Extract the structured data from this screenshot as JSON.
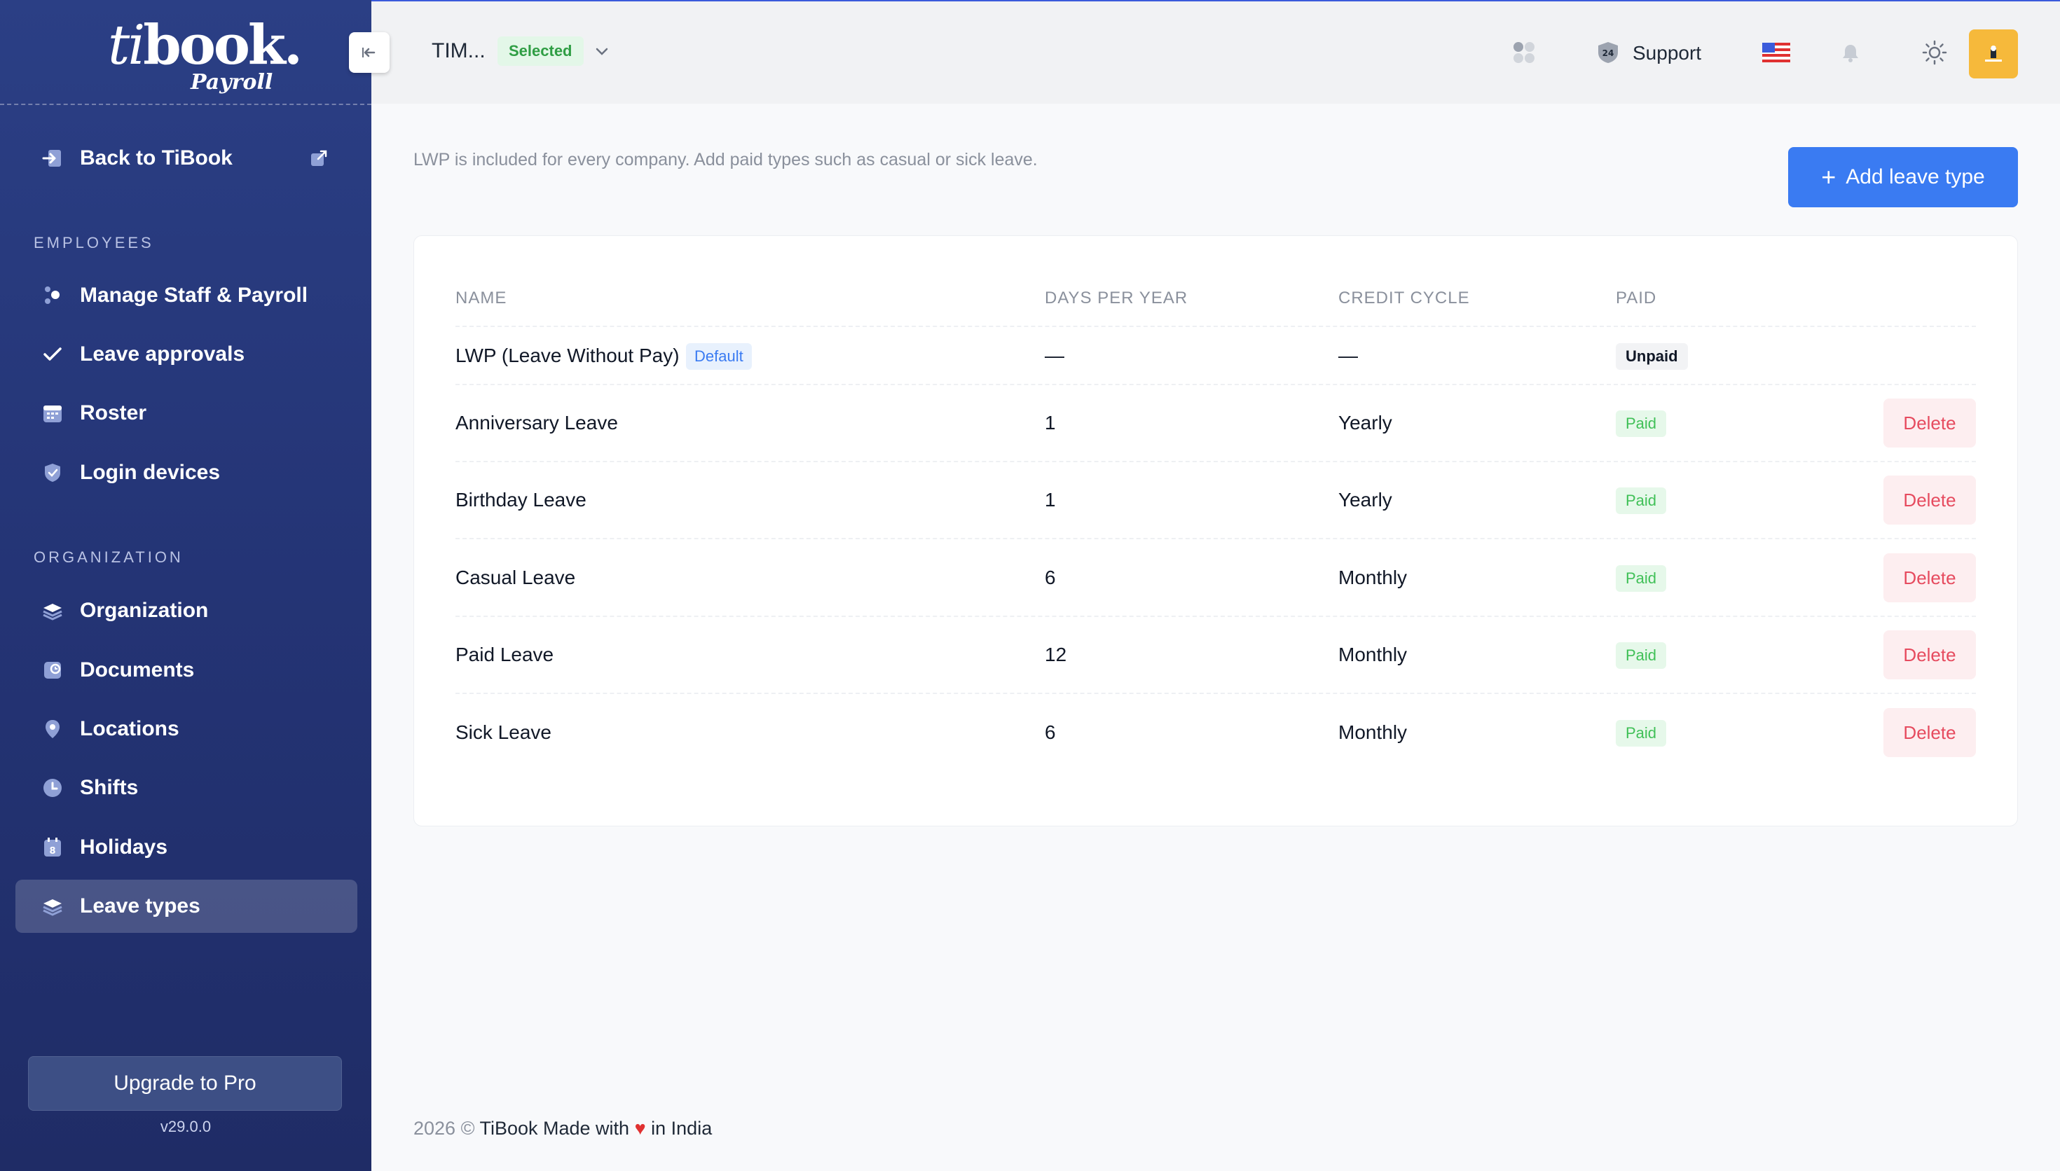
{
  "brand": {
    "logo_ti": "ti",
    "logo_book": "book.",
    "logo_sub": "Payroll"
  },
  "sidebar": {
    "back": "Back to TiBook",
    "section_employees": "EMPLOYEES",
    "section_organization": "ORGANIZATION",
    "items": [
      {
        "label": "Manage Staff & Payroll",
        "icon": "staff-icon"
      },
      {
        "label": "Leave approvals",
        "icon": "check-icon"
      },
      {
        "label": "Roster",
        "icon": "calendar-icon"
      },
      {
        "label": "Login devices",
        "icon": "shield-icon"
      },
      {
        "label": "Organization",
        "icon": "layers-icon"
      },
      {
        "label": "Documents",
        "icon": "document-icon"
      },
      {
        "label": "Locations",
        "icon": "location-pin-icon"
      },
      {
        "label": "Shifts",
        "icon": "clock-icon"
      },
      {
        "label": "Holidays",
        "icon": "calendar-8-icon"
      },
      {
        "label": "Leave types",
        "icon": "layers-icon",
        "active": true
      }
    ],
    "upgrade": "Upgrade to Pro",
    "version": "v29.0.0"
  },
  "header": {
    "company": "TIM...",
    "selected": "Selected",
    "support": "Support",
    "support_badge": "24"
  },
  "main": {
    "description": "LWP is included for every company. Add paid types such as casual or sick leave.",
    "add_button": "Add leave type",
    "columns": [
      "NAME",
      "DAYS PER YEAR",
      "CREDIT CYCLE",
      "PAID"
    ],
    "rows": [
      {
        "name": "LWP (Leave Without Pay)",
        "badge": "Default",
        "days": "—",
        "cycle": "—",
        "paid": "Unpaid"
      },
      {
        "name": "Anniversary Leave",
        "days": "1",
        "cycle": "Yearly",
        "paid": "Paid",
        "action": "Delete"
      },
      {
        "name": "Birthday Leave",
        "days": "1",
        "cycle": "Yearly",
        "paid": "Paid",
        "action": "Delete"
      },
      {
        "name": "Casual Leave",
        "days": "6",
        "cycle": "Monthly",
        "paid": "Paid",
        "action": "Delete"
      },
      {
        "name": "Paid Leave",
        "days": "12",
        "cycle": "Monthly",
        "paid": "Paid",
        "action": "Delete"
      },
      {
        "name": "Sick Leave",
        "days": "6",
        "cycle": "Monthly",
        "paid": "Paid",
        "action": "Delete"
      }
    ]
  },
  "footer": {
    "year": "2026 ©",
    "made": "TiBook Made with",
    "country": "in India"
  },
  "colors": {
    "sidebar": "#243475",
    "accent": "#3a7bf2",
    "paid": "#40c057",
    "delete": "#e64b5f",
    "avatar": "#f6b93b"
  }
}
